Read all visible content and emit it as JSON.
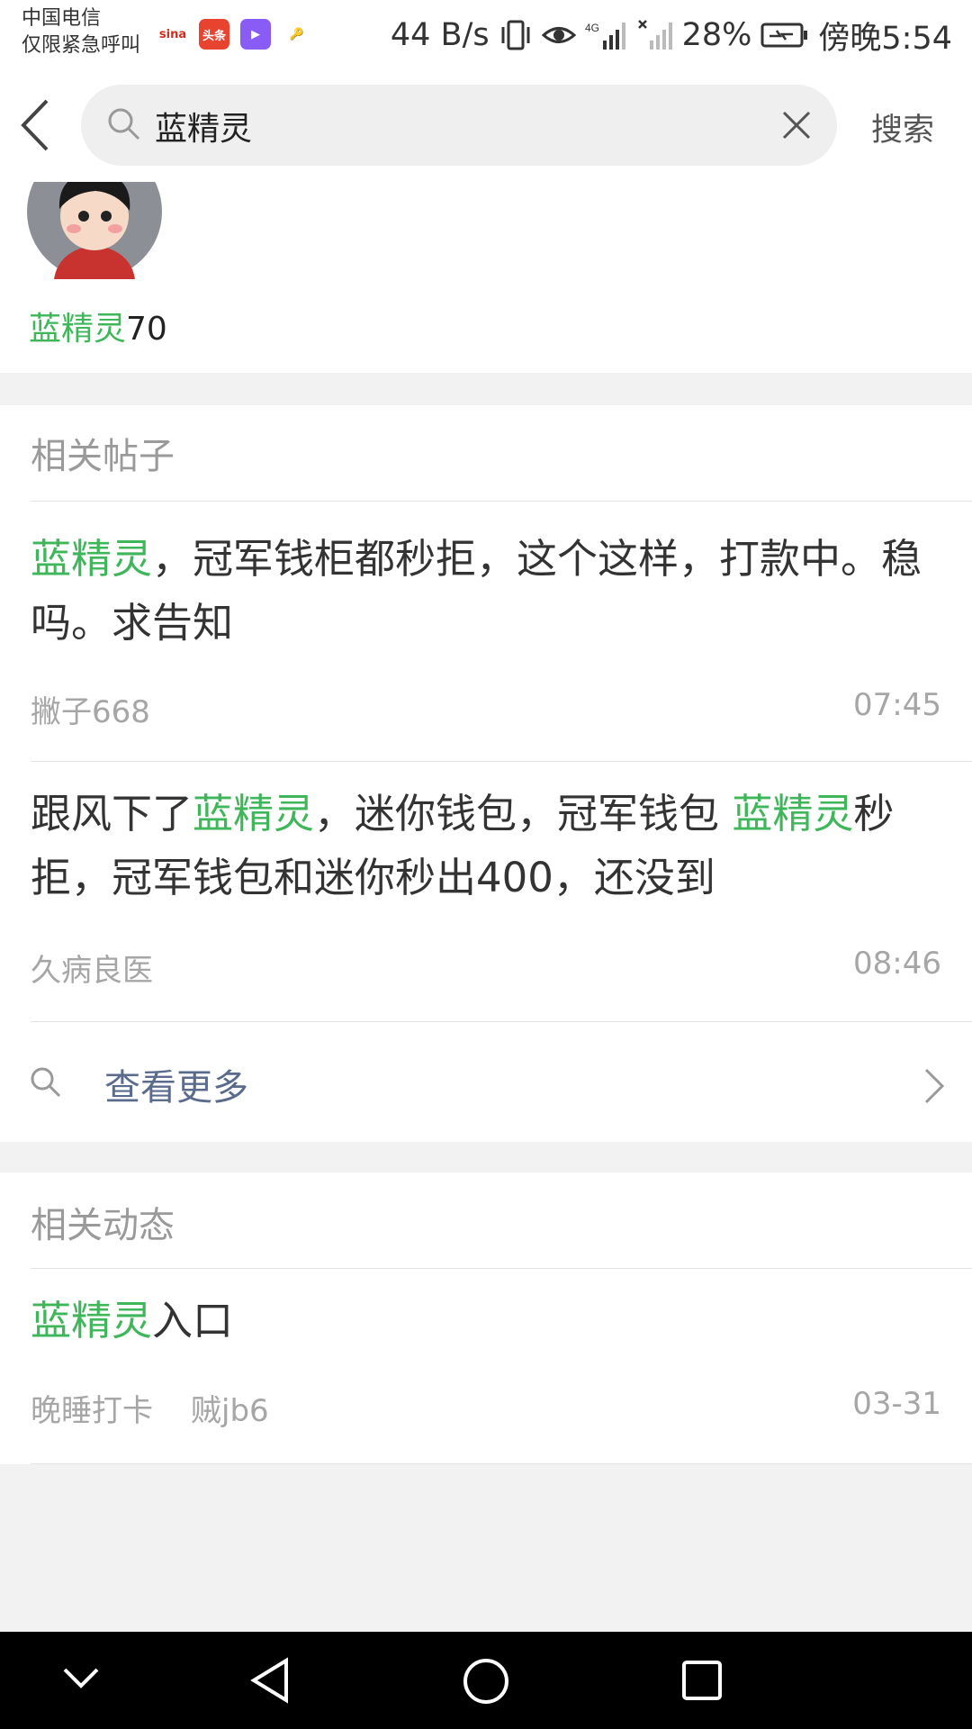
{
  "status_bar": {
    "carrier_line1": "中国电信",
    "carrier_line2": "仅限紧急呼叫",
    "app_icons": [
      {
        "name": "sina-icon",
        "label": "sina",
        "color": "#ffffff",
        "text_color": "#d52b1e"
      },
      {
        "name": "toutiao-icon",
        "label": "头条",
        "color": "#e8432f",
        "text_color": "#ffffff"
      },
      {
        "name": "video-app-icon",
        "label": "▶",
        "color": "#8a5cf6",
        "text_color": "#ffffff"
      },
      {
        "name": "key-icon",
        "label": "🔑",
        "color": "#ffffff",
        "text_color": "#444444"
      }
    ],
    "net_speed": "44 B/s",
    "network_type": "4G",
    "battery": "28%",
    "time": "傍晚5:54"
  },
  "search": {
    "query": "蓝精灵",
    "submit_label": "搜索"
  },
  "user_result": {
    "name_highlight": "蓝精灵",
    "name_suffix": "70"
  },
  "related_posts": {
    "title": "相关帖子",
    "items": [
      {
        "title_parts": [
          {
            "text": "蓝精灵",
            "hl": true
          },
          {
            "text": "，冠军钱柜都秒拒，这个这样，打款中。稳吗。求告知",
            "hl": false
          }
        ],
        "author": "撇子668",
        "time": "07:45"
      },
      {
        "title_parts": [
          {
            "text": "跟风下了",
            "hl": false
          },
          {
            "text": "蓝精灵",
            "hl": true
          },
          {
            "text": "，迷你钱包，冠军钱包 ",
            "hl": false
          },
          {
            "text": "蓝精灵",
            "hl": true
          },
          {
            "text": "秒拒，冠军钱包和迷你秒出400，还没到",
            "hl": false
          }
        ],
        "author": "久病良医",
        "time": "08:46"
      }
    ],
    "more_label": "查看更多"
  },
  "related_moments": {
    "title": "相关动态",
    "items": [
      {
        "title_parts": [
          {
            "text": "蓝精灵",
            "hl": true
          },
          {
            "text": "入口",
            "hl": false
          }
        ],
        "tag": "晚睡打卡",
        "author": "贼jb6",
        "date": "03-31"
      }
    ]
  },
  "colors": {
    "highlight": "#3fb65a",
    "link": "#5b6b8c",
    "background": "#f2f2f2"
  }
}
